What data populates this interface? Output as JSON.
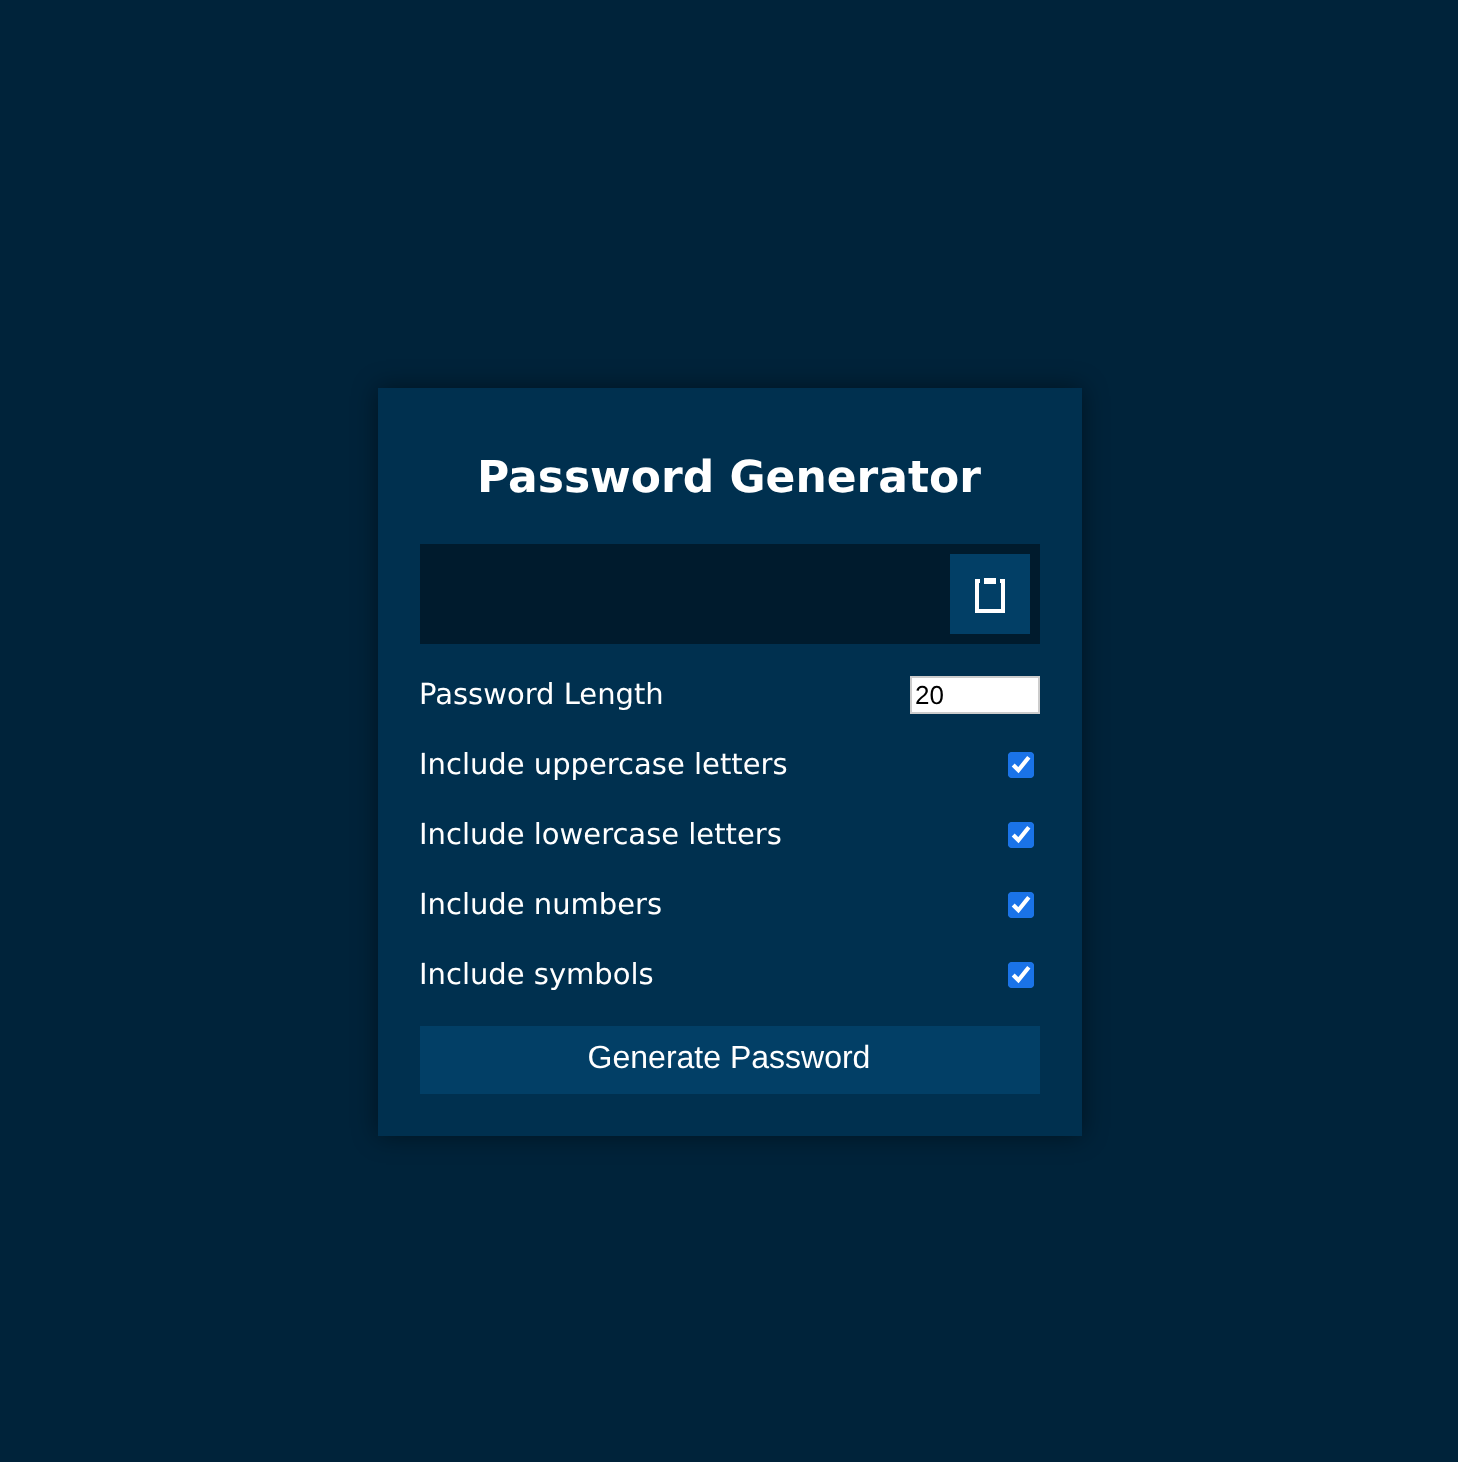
{
  "title": "Password Generator",
  "length": {
    "label": "Password Length",
    "value": "20"
  },
  "options": [
    {
      "label": "Include uppercase letters",
      "checked": true
    },
    {
      "label": "Include lowercase letters",
      "checked": true
    },
    {
      "label": "Include numbers",
      "checked": true
    },
    {
      "label": "Include symbols",
      "checked": true
    }
  ],
  "button": "Generate Password"
}
